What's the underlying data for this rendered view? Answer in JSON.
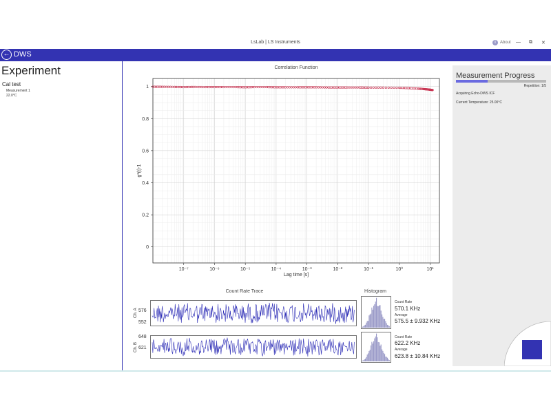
{
  "window": {
    "title": "LsLab | LS Instruments",
    "about_label": "About",
    "minimize_glyph": "—",
    "restore_glyph": "⧉",
    "close_glyph": "✕"
  },
  "appbar": {
    "back_icon": "←",
    "title": "DWS",
    "color": "#3333b2"
  },
  "experiment": {
    "heading": "Experiment",
    "name": "Cal test",
    "measurement": "Measurement 1",
    "temperature": "22.0°C"
  },
  "chart_data": [
    {
      "type": "scatter",
      "title": "Correlation Function",
      "xlabel": "Lag time [s]",
      "ylabel": "g²(t)-1",
      "xscale": "log",
      "xlim": [
        1e-08,
        20
      ],
      "ylim": [
        -0.1,
        1.05
      ],
      "x_ticks": [
        "10⁻⁷",
        "10⁻⁶",
        "10⁻⁵",
        "10⁻⁴",
        "10⁻³",
        "10⁻²",
        "10⁻¹",
        "10⁰",
        "10¹"
      ],
      "y_ticks": [
        "0",
        "0.2",
        "0.4",
        "0.6",
        "0.8",
        "1"
      ],
      "grid": true,
      "marker_color": "#c83250",
      "series": [
        {
          "x": [
            1e-08,
            2e-08,
            5e-08,
            1e-07,
            2e-07,
            5e-07,
            1e-06,
            2e-06,
            5e-06,
            1e-05,
            2e-05,
            5e-05,
            0.0001,
            0.0002,
            0.0005,
            0.001,
            0.002,
            0.005,
            0.01,
            0.02,
            0.05,
            0.1,
            0.3,
            1,
            2,
            4,
            6,
            8,
            10,
            12
          ],
          "y": [
            0.998,
            0.998,
            0.997,
            0.996,
            0.997,
            0.996,
            0.996,
            0.996,
            0.996,
            0.995,
            0.996,
            0.996,
            0.995,
            0.995,
            0.995,
            0.995,
            0.995,
            0.994,
            0.994,
            0.994,
            0.994,
            0.993,
            0.993,
            0.992,
            0.99,
            0.987,
            0.984,
            0.982,
            0.98,
            0.978
          ]
        }
      ]
    }
  ],
  "count_rate": {
    "title": "Count Rate Trace",
    "histogram_title": "Histogram",
    "trace_color": "#2a2ab5",
    "channels": [
      {
        "label": "Ch. A",
        "y_ticks": [
          "576",
          "552"
        ],
        "count_rate_label": "Count Rate",
        "count_rate_value": "570.1 KHz",
        "average_label": "Average",
        "average_value": "575.5 ± 9.932 KHz"
      },
      {
        "label": "Ch. B",
        "y_ticks": [
          "648",
          "621"
        ],
        "count_rate_label": "Count Rate",
        "count_rate_value": "622.2 KHz",
        "average_label": "Average",
        "average_value": "623.8 ± 10.84 KHz"
      }
    ]
  },
  "progress": {
    "title": "Measurement Progress",
    "fraction": 0.35,
    "repetition": "Repetition: 1/5",
    "status": "Acquiring Echo-DWS ICF",
    "temperature": "Current Temperature: 25.00°C",
    "stop_button_color": "#3333b2"
  }
}
